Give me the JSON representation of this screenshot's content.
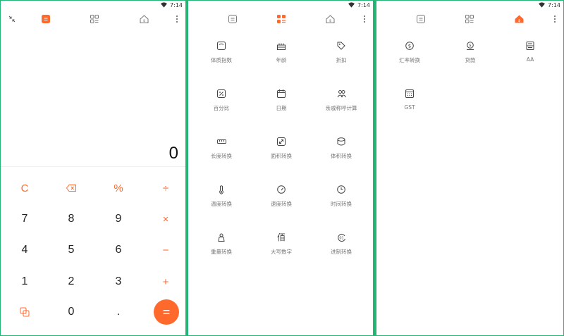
{
  "status": {
    "time": "7:14"
  },
  "colors": {
    "accent": "#ff6a2c",
    "frame": "#22b573"
  },
  "calculator": {
    "result": "0",
    "keys": {
      "clear": "C",
      "percent": "%",
      "divide": "÷",
      "seven": "7",
      "eight": "8",
      "nine": "9",
      "multiply": "×",
      "four": "4",
      "five": "5",
      "six": "6",
      "minus": "−",
      "one": "1",
      "two": "2",
      "three": "3",
      "plus": "+",
      "zero": "0",
      "dot": ".",
      "equals": "="
    }
  },
  "converters": {
    "bmi": "体质指数",
    "age": "年龄",
    "discount": "折扣",
    "percentage": "百分比",
    "date": "日期",
    "relatives": "亲戚称呼计算",
    "length": "长度转换",
    "area": "面积转换",
    "volume": "体积转换",
    "temperature": "温度转换",
    "speed": "速度转换",
    "time": "时间转换",
    "weight": "重量转换",
    "capital_numbers": "大写数字",
    "radix": "进制转换",
    "capital_numbers_glyph": "佰"
  },
  "finance": {
    "exchange": "汇率转换",
    "loan": "贷款",
    "aa": "AA",
    "gst": "GST"
  }
}
